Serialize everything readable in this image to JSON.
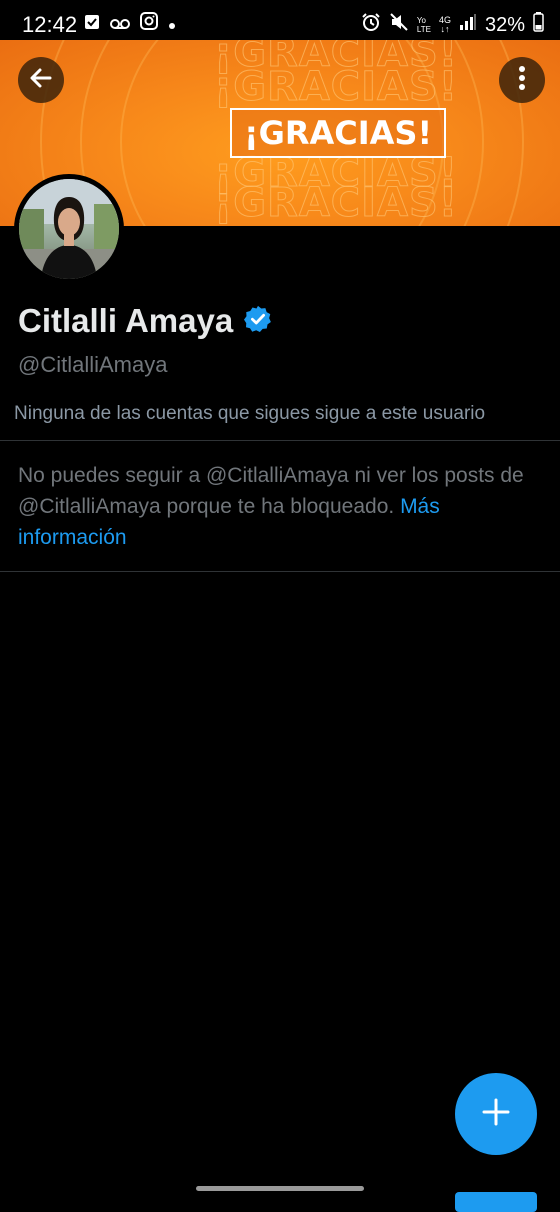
{
  "status_bar": {
    "time": "12:42",
    "battery": "32%",
    "left_icons": [
      "check-box-icon",
      "voicemail-icon",
      "instagram-icon",
      "dot-icon"
    ],
    "right_icons": [
      "alarm-icon",
      "mute-icon",
      "volte-icon",
      "4g-icon",
      "signal-icon",
      "battery-icon"
    ],
    "net_label": "4G",
    "volte_top": "Yo",
    "volte_bottom": "LTE"
  },
  "banner": {
    "text": "¡GRACIAS!",
    "color_primary": "#f7881a"
  },
  "profile": {
    "name": "Citlalli Amaya",
    "handle": "@CitlalliAmaya",
    "verified": true,
    "verified_color": "#1d9bf0"
  },
  "follow_note": "Ninguna de las cuentas que sigues sigue a este usuario",
  "blocked_message": {
    "text": "No puedes seguir a @CitlalliAmaya ni ver los posts de @CitlalliAmaya porque te ha bloqueado.",
    "link": "Más información"
  },
  "colors": {
    "background": "#000000",
    "accent": "#1d9bf0",
    "secondary_text": "#71767b"
  }
}
